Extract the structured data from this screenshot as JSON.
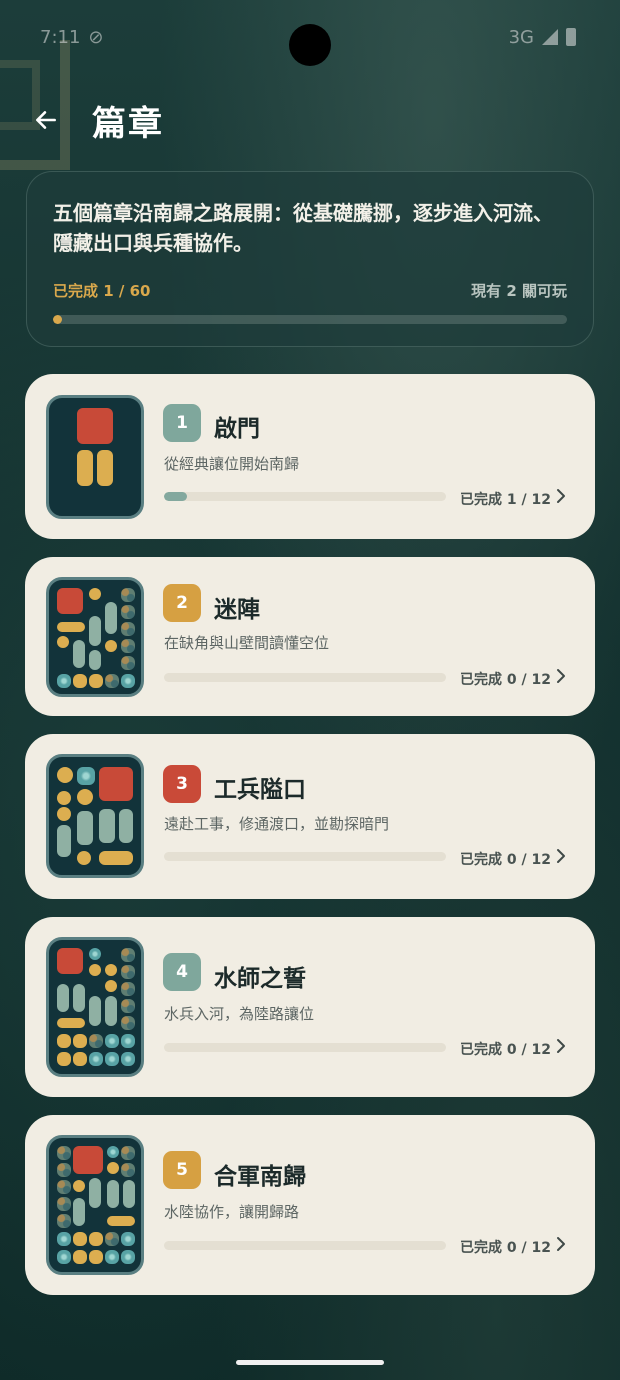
{
  "status_bar": {
    "time": "7:11",
    "network": "3G"
  },
  "header": {
    "title": "篇章"
  },
  "summary": {
    "description": "五個篇章沿南歸之路展開：從基礎騰挪，逐步進入河流、隱藏出口與兵種協作。",
    "completed_label": "已完成 1 / 60",
    "playable_label": "現有 2 關可玩",
    "progress": 0.017
  },
  "colors": {
    "teal_badge": "#7fa79c",
    "gold_badge": "#d6a042",
    "red_badge": "#c94a38",
    "accent_gold": "#d9a84c"
  },
  "chapters": [
    {
      "number": "1",
      "title": "啟門",
      "description": "從經典讓位開始南歸",
      "progress_label": "已完成 1 / 12",
      "progress": 0.083,
      "badge_color": "#7fa79c"
    },
    {
      "number": "2",
      "title": "迷陣",
      "description": "在缺角與山壁間讀懂空位",
      "progress_label": "已完成 0 / 12",
      "progress": 0,
      "badge_color": "#d6a042"
    },
    {
      "number": "3",
      "title": "工兵隘口",
      "description": "遠赴工事，修通渡口，並勘探暗門",
      "progress_label": "已完成 0 / 12",
      "progress": 0,
      "badge_color": "#c94a38"
    },
    {
      "number": "4",
      "title": "水師之誓",
      "description": "水兵入河，為陸路讓位",
      "progress_label": "已完成 0 / 12",
      "progress": 0,
      "badge_color": "#7fa79c"
    },
    {
      "number": "5",
      "title": "合軍南歸",
      "description": "水陸協作，讓開歸路",
      "progress_label": "已完成 0 / 12",
      "progress": 0,
      "badge_color": "#d6a042"
    }
  ]
}
